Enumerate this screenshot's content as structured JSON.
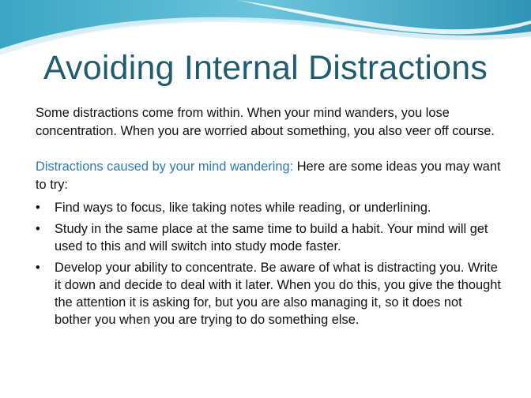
{
  "slide": {
    "title": "Avoiding Internal Distractions",
    "intro": "Some distractions come from within.  When your mind wanders, you lose concentration.  When you are worried about something, you also veer off course.",
    "subheading_accent": "Distractions caused by your mind wandering:",
    "subheading_rest": " Here are some ideas you may want to try:",
    "bullets": [
      "Find ways to focus, like taking notes while reading, or underlining.",
      "Study in the same place at the same time to build a habit.  Your mind will get used to  this and will switch into study mode faster.",
      "Develop your ability to concentrate.  Be aware of what is distracting you.  Write it down and decide to deal with it later.  When you do this, you give the thought the attention it is asking for, but you are also managing it, so it does not bother you when you are trying to do something else."
    ],
    "bullet_symbol": "•"
  },
  "colors": {
    "title": "#1f5d6e",
    "accent": "#2a7cb8",
    "wave_primary": "#4fb3cf",
    "wave_light": "#bfe6f1"
  }
}
